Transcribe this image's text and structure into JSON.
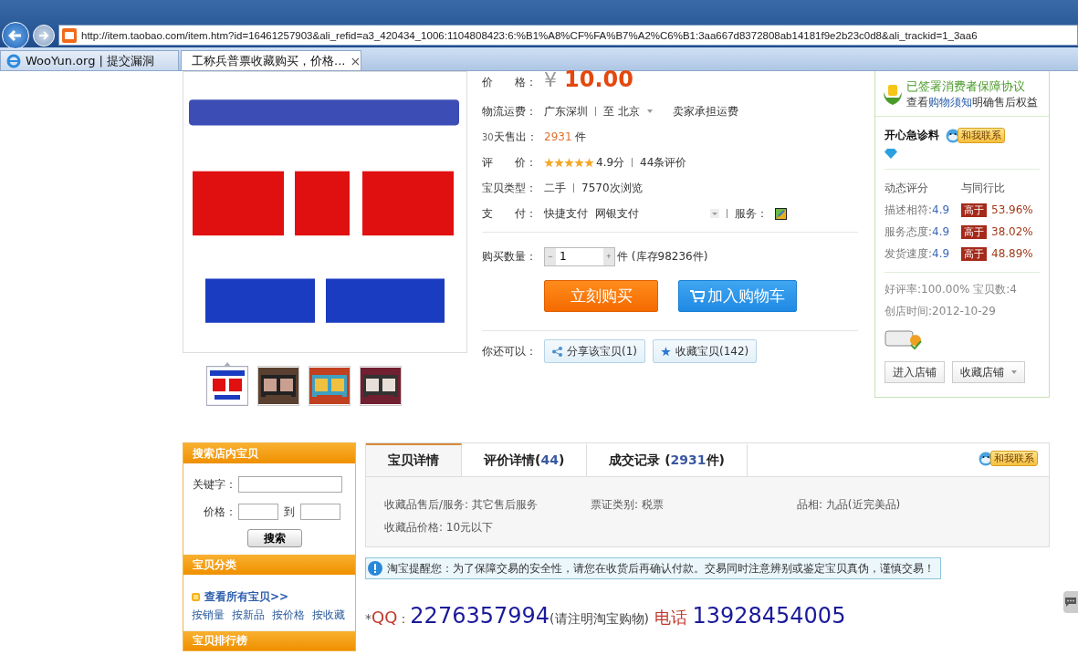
{
  "browser": {
    "address": "http://item.taobao.com/item.htm?id=16461257903&ali_refid=a3_420434_1006:1104808423:6:%B1%A8%CF%FA%B7%A2%C6%B1:3aa667d8372808ab14181f9e2b23c0d8&ali_trackid=1_3aa6",
    "tabs": [
      {
        "label": "WooYun.org | 提交漏洞",
        "selected": false,
        "kind": "ie"
      },
      {
        "label": "工称兵普票收藏购买，价格...",
        "selected": true,
        "kind": "taobao",
        "close": "×"
      }
    ]
  },
  "gallery": {
    "main": {
      "kind": "picture"
    },
    "thumbnails": [
      {
        "kind": "picture",
        "selected": true
      },
      {
        "kind": "picture",
        "selected": false
      },
      {
        "kind": "picture",
        "selected": false
      },
      {
        "kind": "picture",
        "selected": false
      }
    ]
  },
  "product": {
    "price": {
      "label": "价　　格：",
      "currency": "¥",
      "amount": "10.00"
    },
    "shipping": {
      "label": "物流运费：",
      "from": "广东深圳",
      "to": "至 北京",
      "note": "卖家承担运费"
    },
    "sales": {
      "prefix": "30",
      "label": "天售出：",
      "count": "2931",
      "unit": "件"
    },
    "rating": {
      "label": "评　　价：",
      "stars": 5,
      "score": "4.9分",
      "reviews": "44条评价"
    },
    "type": {
      "label": "宝贝类型：",
      "value": "二手",
      "views": "7570次浏览"
    },
    "payment": {
      "label": "支　　付：",
      "methods": [
        "快捷支付",
        "网银支付"
      ],
      "service_label": "服务："
    },
    "quantity": {
      "label": "购买数量：",
      "minus": "−",
      "value": "1",
      "plus": "+",
      "unit": "件",
      "stock": "(库存98236件)"
    },
    "buttons": [
      {
        "kind": "buy",
        "label": "立刻购买"
      },
      {
        "kind": "cart",
        "label": "加入购物车"
      }
    ],
    "share": {
      "label": "你还可以：",
      "actions": [
        {
          "kind": "share",
          "label": "分享该宝贝(1)"
        },
        {
          "kind": "favorite",
          "label": "收藏宝贝(142)"
        }
      ]
    }
  },
  "seller": {
    "guarantee_title": "已签署消费者保障协议",
    "guarantee": {
      "before": "查看",
      "link": "购物须知",
      "after": "明确售后权益"
    },
    "name": "开心急诊料",
    "contact": "和我联系",
    "ratings_header": [
      "动态评分",
      "与同行比"
    ],
    "ratings": [
      {
        "label": "描述相符:",
        "score": "4.9",
        "badge": "高于",
        "percent": "53.96%"
      },
      {
        "label": "服务态度:",
        "score": "4.9",
        "badge": "高于",
        "percent": "38.02%"
      },
      {
        "label": "发货速度:",
        "score": "4.9",
        "badge": "高于",
        "percent": "48.89%"
      }
    ],
    "stats": [
      "好评率:100.00% 宝贝数:4",
      "创店时间:2012-10-29"
    ],
    "buttons": [
      {
        "kind": "plain",
        "label": "进入店铺"
      },
      {
        "kind": "dropdown",
        "label": "收藏店铺"
      }
    ]
  },
  "sidebar": {
    "search": {
      "title": "搜索店内宝贝",
      "keyword_label": "关键字：",
      "price_label": "价格：",
      "to": "到",
      "button": "搜索"
    },
    "category": {
      "title": "宝贝分类",
      "all": "查看所有宝贝>>",
      "sorts": [
        "按销量",
        "按新品",
        "按价格",
        "按收藏"
      ]
    },
    "rank": {
      "title": "宝贝排行榜"
    }
  },
  "detail": {
    "tabs": [
      {
        "label": "宝贝详情",
        "selected": true
      },
      {
        "label": "评价详情(",
        "count": "44",
        "suffix": ")",
        "selected": false
      },
      {
        "label": "成交记录 (",
        "count": "2931",
        "suffix": "件)",
        "selected": false
      }
    ],
    "contact": "和我联系",
    "attributes": [
      "收藏品售后/服务: 其它售后服务",
      "票证类别: 税票",
      "品相: 九品(近完美品)",
      "收藏品价格: 10元以下"
    ],
    "notice": "淘宝提醒您：为了保障交易的安全性，请您在收货后再确认付款。交易同时注意辨别或鉴定宝贝真伪，谨慎交易！",
    "contact_line": [
      {
        "kind": "star",
        "text": "*"
      },
      {
        "kind": "label",
        "text": "QQ"
      },
      {
        "kind": "sep",
        "text": "："
      },
      {
        "kind": "number",
        "text": "2276357994"
      },
      {
        "kind": "note",
        "text": "(请注明淘宝购物)"
      },
      {
        "kind": "label",
        "text": " 电话 "
      },
      {
        "kind": "number",
        "text": "13928454005"
      }
    ]
  }
}
